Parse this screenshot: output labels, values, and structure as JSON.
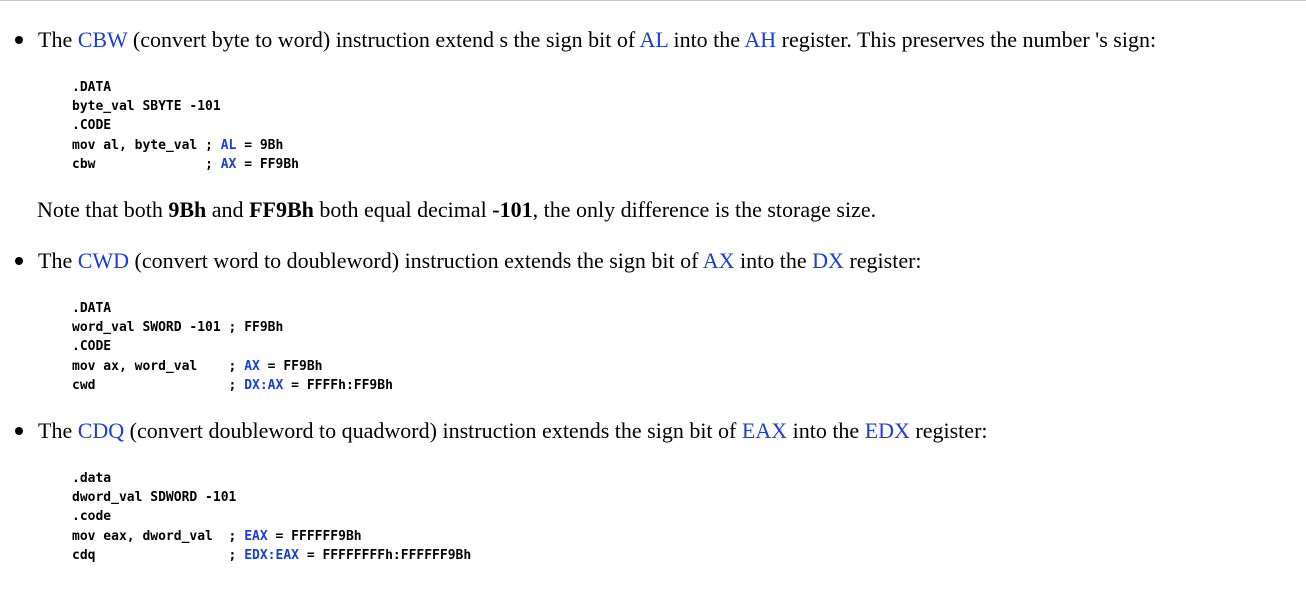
{
  "colors": {
    "keyword": "#1a3fd6",
    "text": "#000000",
    "background": "#ffffff"
  },
  "bullets": [
    {
      "prefix": "The ",
      "keyword": "CBW",
      "middle1": " (convert byte to word) instruction extend s the sign bit of ",
      "reg1": "AL",
      "middle2": " into the ",
      "reg2": "AH",
      "suffix": " register. This preserves the number 's sign:"
    },
    {
      "prefix": "The ",
      "keyword": "CWD",
      "middle1": " (convert word to doubleword) instruction extends the sign bit of ",
      "reg1": "AX",
      "middle2": " into the ",
      "reg2": "DX",
      "suffix": " register:"
    },
    {
      "prefix": "The ",
      "keyword": "CDQ",
      "middle1": " (convert doubleword to quadword) instruction extends the sign bit of ",
      "reg1": "EAX",
      "middle2": " into the ",
      "reg2": "EDX",
      "suffix": " register:"
    }
  ],
  "note": {
    "prefix": "Note that both ",
    "b1": "9Bh",
    "mid1": " and ",
    "b2": "FF9Bh",
    "mid2": " both equal decimal ",
    "b3": "-101",
    "suffix": ", the only difference is the storage size."
  },
  "code_blocks": [
    {
      "lines": [
        {
          "code": ".DATA",
          "comment_prefix": "",
          "comment_reg": "",
          "comment_rest": ""
        },
        {
          "code": "byte_val SBYTE -101",
          "comment_prefix": "",
          "comment_reg": "",
          "comment_rest": ""
        },
        {
          "code": ".CODE",
          "comment_prefix": "",
          "comment_reg": "",
          "comment_rest": ""
        },
        {
          "code": "mov al, byte_val ",
          "comment_prefix": "; ",
          "comment_reg": "AL",
          "comment_rest": " = 9Bh"
        },
        {
          "code": "cbw              ",
          "comment_prefix": "; ",
          "comment_reg": "AX",
          "comment_rest": " = FF9Bh"
        }
      ]
    },
    {
      "lines": [
        {
          "code": ".DATA",
          "comment_prefix": "",
          "comment_reg": "",
          "comment_rest": ""
        },
        {
          "code": "word_val SWORD -101 ",
          "comment_prefix": "; ",
          "comment_reg": "",
          "comment_rest": "FF9Bh"
        },
        {
          "code": ".CODE",
          "comment_prefix": "",
          "comment_reg": "",
          "comment_rest": ""
        },
        {
          "code": "mov ax, word_val    ",
          "comment_prefix": "; ",
          "comment_reg": "AX",
          "comment_rest": " = FF9Bh"
        },
        {
          "code": "cwd                 ",
          "comment_prefix": "; ",
          "comment_reg": "DX:AX",
          "comment_rest": " = FFFFh:FF9Bh"
        }
      ]
    },
    {
      "lines": [
        {
          "code": ".data",
          "comment_prefix": "",
          "comment_reg": "",
          "comment_rest": ""
        },
        {
          "code": "dword_val SDWORD -101",
          "comment_prefix": "",
          "comment_reg": "",
          "comment_rest": ""
        },
        {
          "code": ".code",
          "comment_prefix": "",
          "comment_reg": "",
          "comment_rest": ""
        },
        {
          "code": "mov eax, dword_val  ",
          "comment_prefix": "; ",
          "comment_reg": "EAX",
          "comment_rest": " = FFFFFF9Bh"
        },
        {
          "code": "cdq                 ",
          "comment_prefix": "; ",
          "comment_reg": "EDX:EAX",
          "comment_rest": " = FFFFFFFFh:FFFFFF9Bh"
        }
      ]
    }
  ]
}
